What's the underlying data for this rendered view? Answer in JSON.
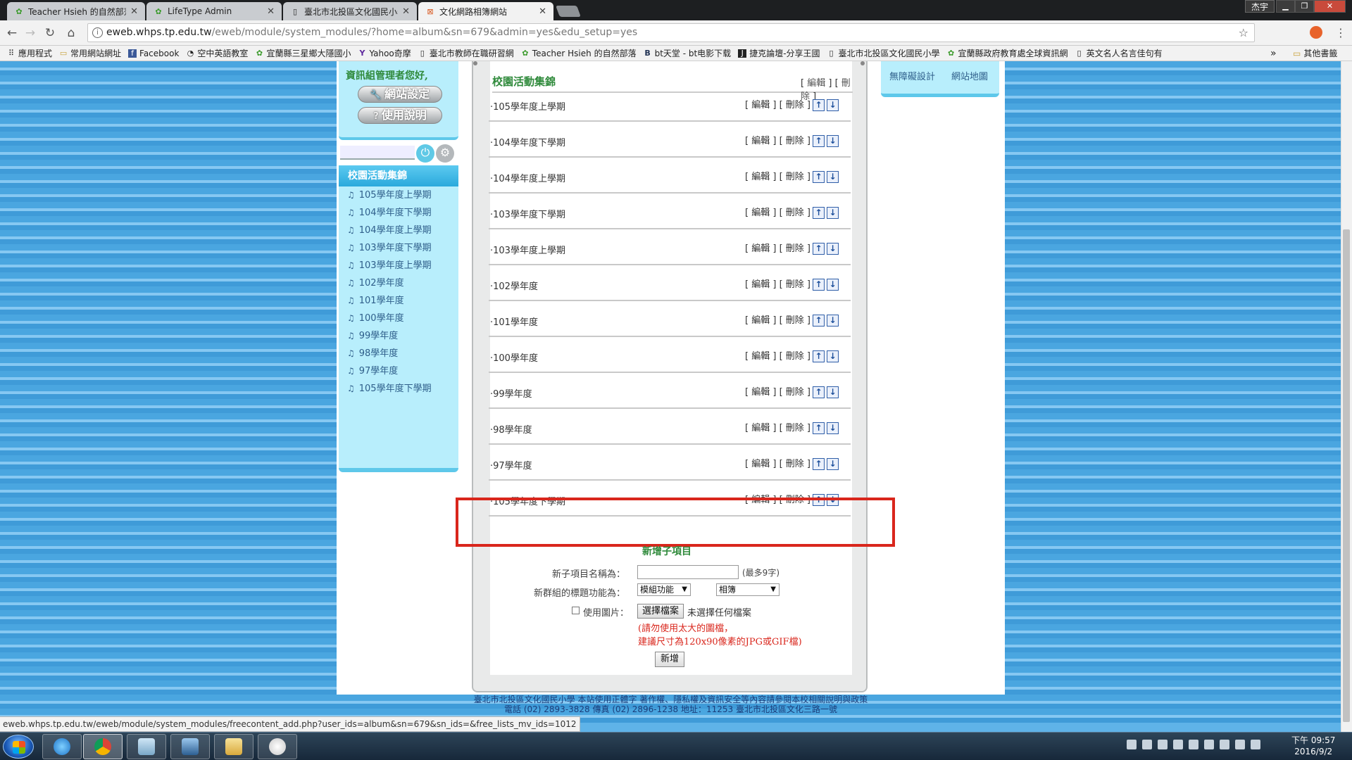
{
  "browser": {
    "tabs": [
      {
        "label": "Teacher Hsieh 的自然部落格",
        "icon": "leaf-icon"
      },
      {
        "label": "LifeType Admin",
        "icon": "leaf-icon"
      },
      {
        "label": "臺北市北投區文化國民小學",
        "icon": "page-icon"
      },
      {
        "label": "文化網路相簿網站",
        "icon": "site-icon"
      }
    ],
    "window_user": "杰宇",
    "url_domain": "eweb.whps.tp.edu.tw",
    "url_path": "/eweb/module/system_modules/?home=album&sn=679&admin=yes&edu_setup=yes",
    "bookmarks": [
      {
        "label": "應用程式",
        "icon": "apps-icon"
      },
      {
        "label": "常用網站網址",
        "icon": "folder-icon"
      },
      {
        "label": "Facebook",
        "icon": "facebook-icon"
      },
      {
        "label": "空中英語教室",
        "icon": "site-icon"
      },
      {
        "label": "宜蘭縣三星鄉大隱國小",
        "icon": "leaf-icon"
      },
      {
        "label": "Yahoo奇摩",
        "icon": "yahoo-icon"
      },
      {
        "label": "臺北市教師在職研習網",
        "icon": "page-icon"
      },
      {
        "label": "Teacher Hsieh 的自然部落",
        "icon": "leaf-icon"
      },
      {
        "label": "bt天堂 - bt电影下载",
        "icon": "bt-icon"
      },
      {
        "label": "捷克論壇-分享王國",
        "icon": "jk-icon"
      },
      {
        "label": "臺北市北投區文化國民小學",
        "icon": "page-icon"
      },
      {
        "label": "宜蘭縣政府教育處全球資訊網",
        "icon": "leaf-icon"
      },
      {
        "label": "英文名人名言佳句有",
        "icon": "page-icon"
      }
    ],
    "bookmarks_more": "»",
    "bookmarks_other": "其他書籤"
  },
  "sidebar": {
    "greeting": "資訊組管理者您好,",
    "site_settings": "網站設定",
    "user_guide": "使用說明",
    "menu_title": "校園活動集錦",
    "items": [
      "105學年度上學期",
      "104學年度下學期",
      "104學年度上學期",
      "103學年度下學期",
      "103學年度上學期",
      "102學年度",
      "101學年度",
      "100學年度",
      "99學年度",
      "98學年度",
      "97學年度",
      "105學年度下學期"
    ]
  },
  "main": {
    "title": "校園活動集錦",
    "edit": "編輯",
    "delete": "刪除",
    "rows": [
      "·105學年度上學期",
      "·104學年度下學期",
      "·104學年度上學期",
      "·103學年度下學期",
      "·103學年度上學期",
      "·102學年度",
      "·101學年度",
      "·100學年度",
      "·99學年度",
      "·98學年度",
      "·97學年度",
      "·105學年度下學期"
    ]
  },
  "form": {
    "title": "新增子項目",
    "name_label": "新子項目名稱為：",
    "name_value": "",
    "name_hint": "(最多9字)",
    "func_label": "新群組的標題功能為：",
    "func_select": "模組功能",
    "func_select2": "相簿",
    "image_label": "使用圖片：",
    "choose_file": "選擇檔案",
    "no_file": "未選擇任何檔案",
    "warn1": "(請勿使用太大的圖檔，",
    "warn2": "建議尺寸為120x90像素的JPG或GIF檔)",
    "submit": "新增"
  },
  "right": {
    "accessibility": "無障礙設計",
    "sitemap": "網站地圖"
  },
  "footer": {
    "line1": "臺北市北投區文化國民小學 本站使用正體字 著作權、隱私權及資訊安全等內容請參閱本校相關說明與政策",
    "line2": "電話 (02) 2893-3828 傳真 (02) 2896-1238 地址：11253 臺北市北投區文化三路一號"
  },
  "status_url": "eweb.whps.tp.edu.tw/eweb/module/system_modules/freecontent_add.php?user_ids=album&sn=679&sn_ids=&free_lists_mv_ids=1012",
  "clock": {
    "time": "下午 09:57",
    "date": "2016/9/2"
  }
}
